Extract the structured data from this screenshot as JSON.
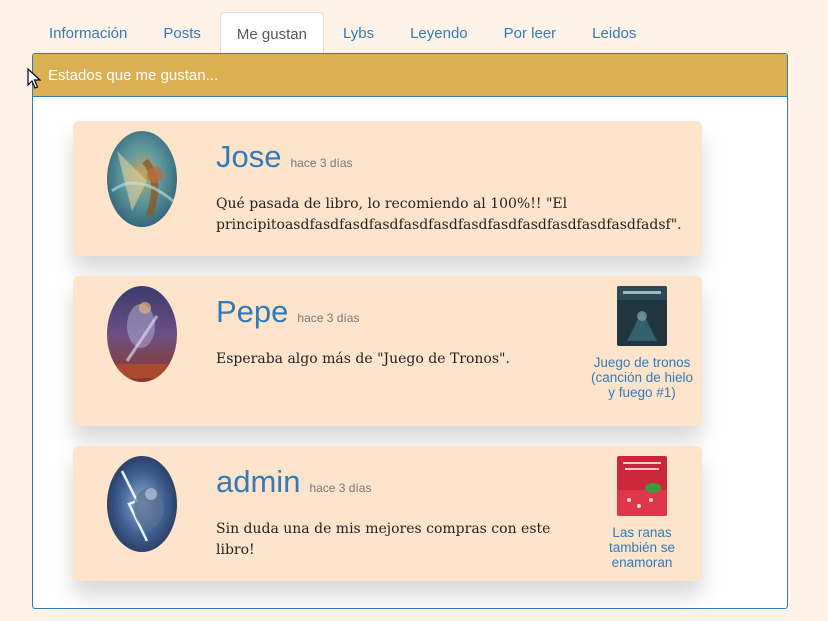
{
  "tabs": [
    {
      "label": "Información",
      "active": false
    },
    {
      "label": "Posts",
      "active": false
    },
    {
      "label": "Me gustan",
      "active": true
    },
    {
      "label": "Lybs",
      "active": false
    },
    {
      "label": "Leyendo",
      "active": false
    },
    {
      "label": "Por leer",
      "active": false
    },
    {
      "label": "Leidos",
      "active": false
    }
  ],
  "panel": {
    "heading": "Estados que me gustan..."
  },
  "posts": [
    {
      "user": "Jose",
      "time": "hace 3 días",
      "message": "Qué pasada de libro, lo recomiendo al 100%!! \"El principitoasdfasdfasdfasdfasdfasdfasdfasdfasdfasdfasdfasdfadsf\".",
      "book": null
    },
    {
      "user": "Pepe",
      "time": "hace 3 días",
      "message": "Esperaba algo más de \"Juego de Tronos\".",
      "book": {
        "title": "Juego de tronos (canción de hielo y fuego #1)"
      }
    },
    {
      "user": "admin",
      "time": "hace 3 días",
      "message": "Sin duda una de mis mejores compras con este libro!",
      "book": {
        "title": "Las ranas también se enamoran"
      }
    }
  ],
  "colors": {
    "page_background": "#fff3e8",
    "heading_background": "#dab052",
    "card_background": "#ffe4cc",
    "link": "#337ab7",
    "panel_border": "#337ab7"
  },
  "icons": [
    "mouse-cursor-icon"
  ]
}
